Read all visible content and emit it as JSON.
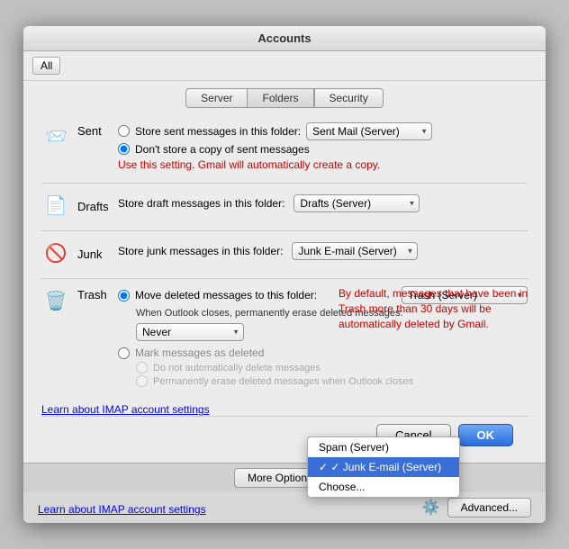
{
  "window": {
    "title": "Accounts"
  },
  "toolbar": {
    "all_label": "All"
  },
  "tabs": [
    {
      "id": "server",
      "label": "Server",
      "active": false
    },
    {
      "id": "folders",
      "label": "Folders",
      "active": true
    },
    {
      "id": "security",
      "label": "Security",
      "active": false
    }
  ],
  "sections": {
    "sent": {
      "label": "Sent",
      "icon": "📨",
      "option1": {
        "id": "store-sent",
        "label": "Store sent messages in this folder:",
        "checked": false
      },
      "option1_select": "Sent Mail (Server)",
      "option2": {
        "id": "dont-store",
        "label": "Don't store a copy of sent messages",
        "checked": true
      },
      "hint": "Use this setting. Gmail will automatically create a copy."
    },
    "drafts": {
      "label": "Drafts",
      "icon": "📝",
      "label_text": "Store draft messages in this folder:",
      "select": "Drafts (Server)"
    },
    "junk": {
      "label": "Junk",
      "icon": "🚫",
      "label_text": "Store junk messages in this folder:",
      "select": "Junk E-mail (Server)",
      "dropdown": {
        "items": [
          {
            "id": "spam",
            "label": "Spam (Server)",
            "selected": false
          },
          {
            "id": "junk",
            "label": "Junk E-mail (Server)",
            "selected": true
          },
          {
            "id": "choose",
            "label": "Choose...",
            "selected": false
          }
        ]
      }
    },
    "trash": {
      "label": "Trash",
      "icon": "🗑️",
      "move_option": {
        "label": "Move deleted messages to this folder:",
        "checked": true
      },
      "move_select": "Trash (Server)",
      "when_closes": "When Outlook closes, permanently erase deleted messages:",
      "never_select": "Never",
      "never_options": [
        "Never"
      ],
      "note": "By default, messages that have been in Trash more than 30 days will be automatically deleted by Gmail.",
      "mark_option": {
        "label": "Mark messages as deleted",
        "checked": false
      },
      "sub_options": [
        "Do not automatically delete messages",
        "Permanently erase deleted messages when Outlook closes"
      ]
    }
  },
  "learn_link": "Learn about IMAP account settings",
  "buttons": {
    "cancel": "Cancel",
    "ok": "OK"
  },
  "footer": {
    "more_options": "More Options...",
    "learn_link": "Learn about IMAP account settings",
    "advanced": "Advanced..."
  }
}
